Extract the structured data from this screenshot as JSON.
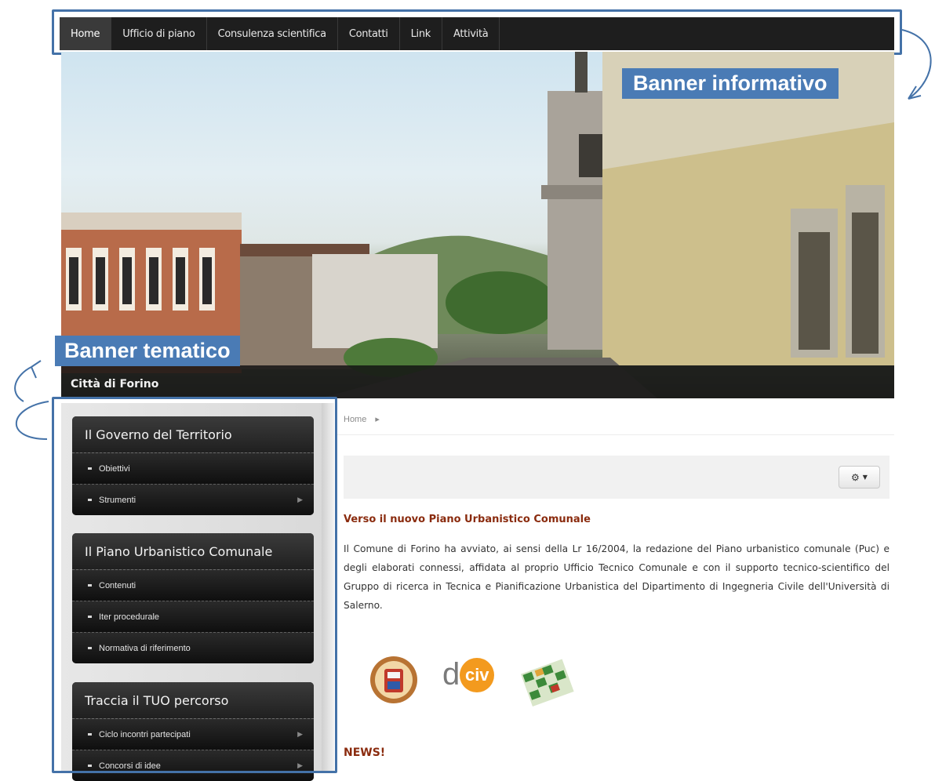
{
  "nav": {
    "items": [
      {
        "label": "Home",
        "active": true
      },
      {
        "label": "Ufficio di piano",
        "active": false
      },
      {
        "label": "Consulenza scientifica",
        "active": false
      },
      {
        "label": "Contatti",
        "active": false
      },
      {
        "label": "Link",
        "active": false
      },
      {
        "label": "Attività",
        "active": false
      }
    ]
  },
  "annotations": {
    "banner_informativo": "Banner informativo",
    "banner_tematico": "Banner tematico",
    "frame_color": "#4472a8",
    "callout_color": "#4a7bb5"
  },
  "hero": {
    "caption": "Città di Forino"
  },
  "sidebar": {
    "menus": [
      {
        "title": "Il Governo del Territorio",
        "items": [
          {
            "label": "Obiettivi",
            "has_submenu": false
          },
          {
            "label": "Strumenti",
            "has_submenu": true
          }
        ]
      },
      {
        "title": "Il Piano Urbanistico Comunale",
        "items": [
          {
            "label": "Contenuti",
            "has_submenu": false
          },
          {
            "label": "Iter procedurale",
            "has_submenu": false
          },
          {
            "label": "Normativa di riferimento",
            "has_submenu": false
          }
        ]
      },
      {
        "title": "Traccia il TUO percorso",
        "items": [
          {
            "label": "Ciclo incontri partecipati",
            "has_submenu": true
          },
          {
            "label": "Concorsi di idee",
            "has_submenu": true
          }
        ]
      }
    ]
  },
  "main": {
    "breadcrumb": "Home",
    "settings_icon": "gear-icon",
    "article_title": "Verso il nuovo Piano Urbanistico Comunale",
    "article_body": "Il Comune di Forino ha avviato, ai sensi della Lr 16/2004, la redazione del Piano urbanistico comunale (Puc) e degli elaborati connessi, affidata al proprio Ufficio Tecnico Comunale e con il supporto tecnico-scientifico del Gruppo di ricerca in Tecnica e Pianificazione Urbanistica del Dipartimento di Ingegneria Civile dell'Università di Salerno.",
    "logos": {
      "dciv_d": "d",
      "dciv_civ": "civ"
    },
    "news_title": "NEWS!"
  },
  "colors": {
    "nav_bg": "#1e1e1e",
    "accent_title": "#8a2b0e",
    "dciv_orange": "#f39a1e"
  }
}
